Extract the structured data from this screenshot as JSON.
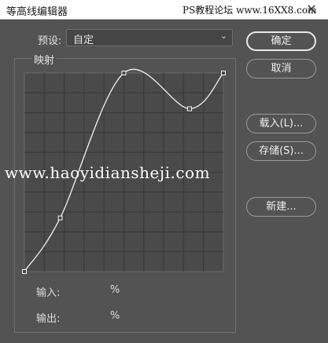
{
  "window": {
    "title": "等高线编辑器",
    "site_watermark": "PS教程论坛 www.16XX8.com",
    "close_glyph": "✕"
  },
  "preset": {
    "label": "预设:",
    "value": "自定"
  },
  "mapping": {
    "label": "映射",
    "grid_divisions": 10,
    "curve_points": [
      {
        "input": 0,
        "output": 0
      },
      {
        "input": 18,
        "output": 27
      },
      {
        "input": 50,
        "output": 100
      },
      {
        "input": 83,
        "output": 82
      },
      {
        "input": 100,
        "output": 100
      }
    ]
  },
  "buttons": {
    "ok": "确定",
    "cancel": "取消",
    "load": "载入(L)...",
    "save": "存储(S)...",
    "new": "新建..."
  },
  "io": {
    "input_label": "输入:",
    "output_label": "输出:",
    "unit": "%"
  },
  "overlay": {
    "watermark": "www.haoyidiansheji.com"
  },
  "colors": {
    "background": "#535353",
    "grid_bg": "#4a4a4a",
    "grid_line": "#3a3a3a",
    "curve": "#f2f2f2"
  }
}
